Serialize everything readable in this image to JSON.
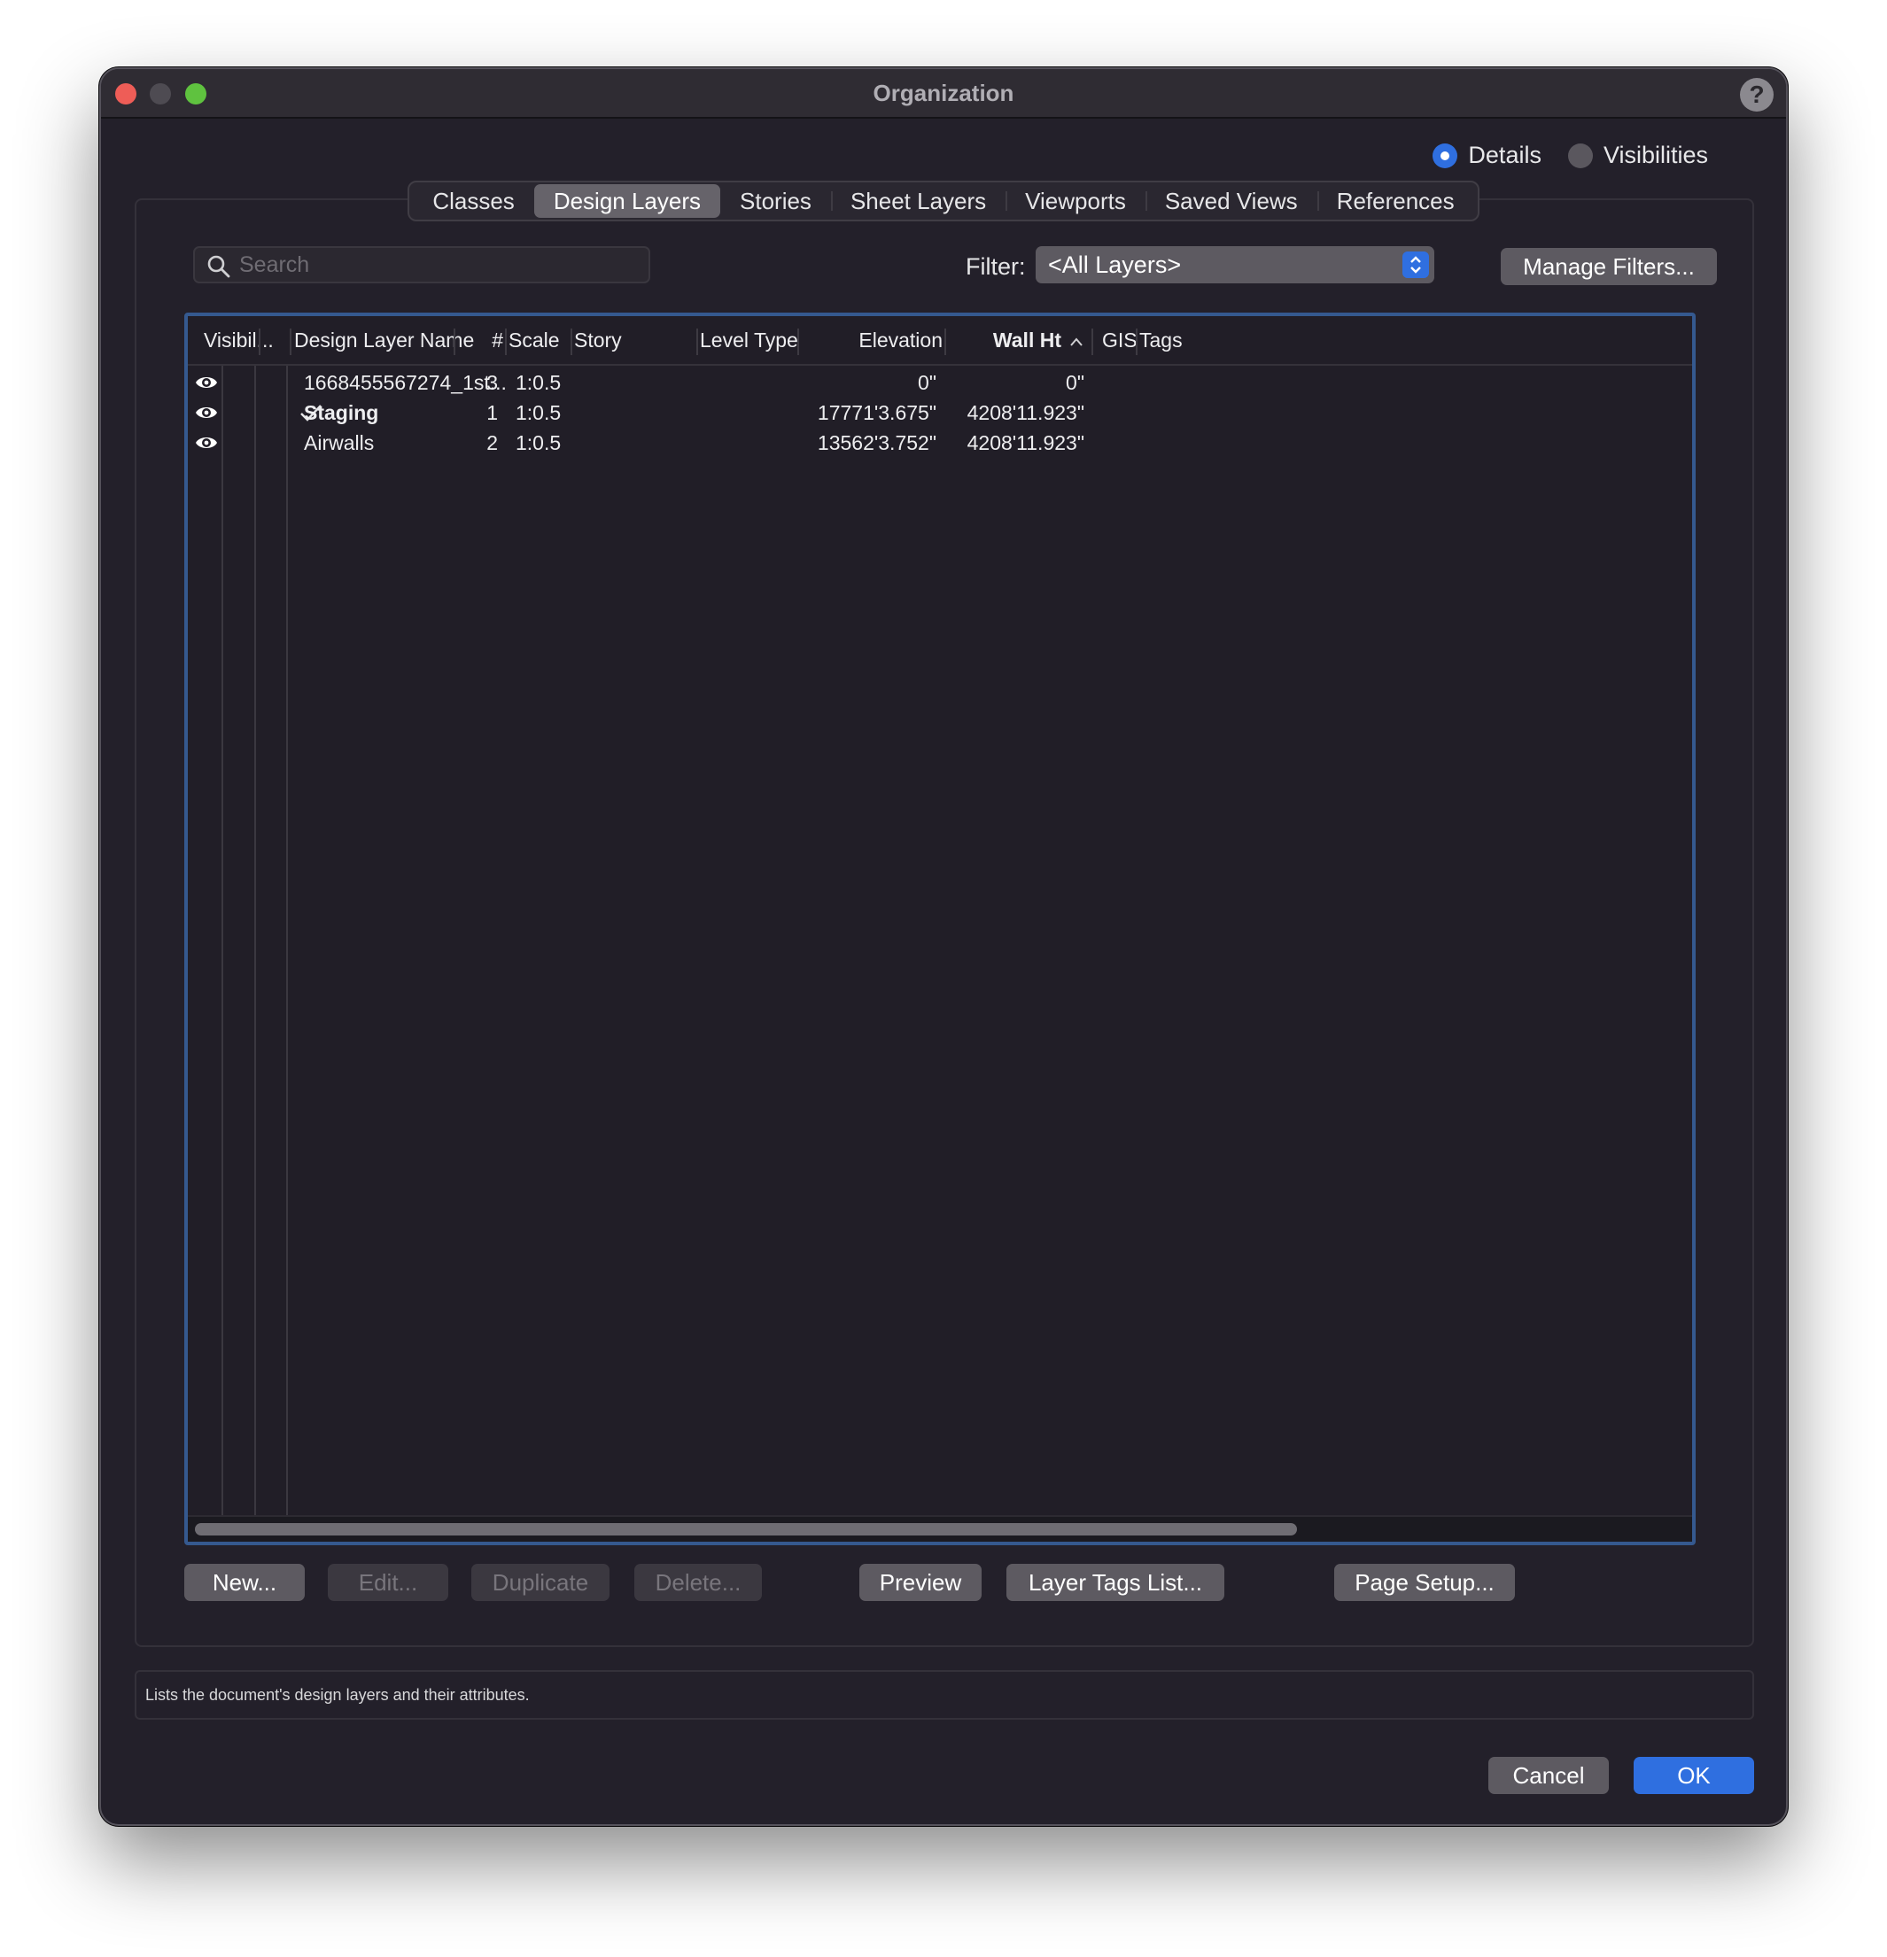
{
  "window": {
    "title": "Organization",
    "help_label": "?"
  },
  "mode": {
    "details_label": "Details",
    "visibilities_label": "Visibilities",
    "selected": "Details"
  },
  "tabs": [
    {
      "label": "Classes"
    },
    {
      "label": "Design Layers",
      "active": true
    },
    {
      "label": "Stories"
    },
    {
      "label": "Sheet Layers"
    },
    {
      "label": "Viewports"
    },
    {
      "label": "Saved Views"
    },
    {
      "label": "References"
    }
  ],
  "search": {
    "placeholder": "Search",
    "value": ""
  },
  "filter": {
    "label": "Filter:",
    "value": "<All Layers>"
  },
  "manage_filters_label": "Manage Filters...",
  "table": {
    "headers": {
      "visibility": "Visibil...",
      "name": "Design Layer Name",
      "number": "#",
      "scale": "Scale",
      "story": "Story",
      "level_type": "Level Type",
      "elevation": "Elevation",
      "wall_ht": "Wall Ht",
      "gis": "GIS",
      "tags": "Tags"
    },
    "sort_column": "Wall Ht",
    "rows": [
      {
        "visible": true,
        "active": false,
        "name": "1668455567274_1st...",
        "number": "3",
        "scale": "1:0.5",
        "story": "",
        "level_type": "",
        "elevation": "0\"",
        "wall_ht": "0\"",
        "gis": "",
        "tags": ""
      },
      {
        "visible": true,
        "active": true,
        "name": "Staging",
        "number": "1",
        "scale": "1:0.5",
        "story": "",
        "level_type": "",
        "elevation": "17771'3.675\"",
        "wall_ht": "4208'11.923\"",
        "gis": "",
        "tags": ""
      },
      {
        "visible": true,
        "active": false,
        "name": "Airwalls",
        "number": "2",
        "scale": "1:0.5",
        "story": "",
        "level_type": "",
        "elevation": "13562'3.752\"",
        "wall_ht": "4208'11.923\"",
        "gis": "",
        "tags": ""
      }
    ]
  },
  "buttons": {
    "new": "New...",
    "edit": "Edit...",
    "duplicate": "Duplicate",
    "delete": "Delete...",
    "preview": "Preview",
    "layer_tags": "Layer Tags List...",
    "page_setup": "Page Setup..."
  },
  "status_text": "Lists the document's design layers and their attributes.",
  "dialog": {
    "cancel": "Cancel",
    "ok": "OK"
  },
  "colors": {
    "accent": "#2f6fe0",
    "window_bg": "#23202a",
    "table_focus": "#35598f"
  },
  "icons": [
    "eye-icon",
    "checkmark-icon",
    "search-icon",
    "chevron-updown-icon",
    "sort-ascending-icon"
  ]
}
